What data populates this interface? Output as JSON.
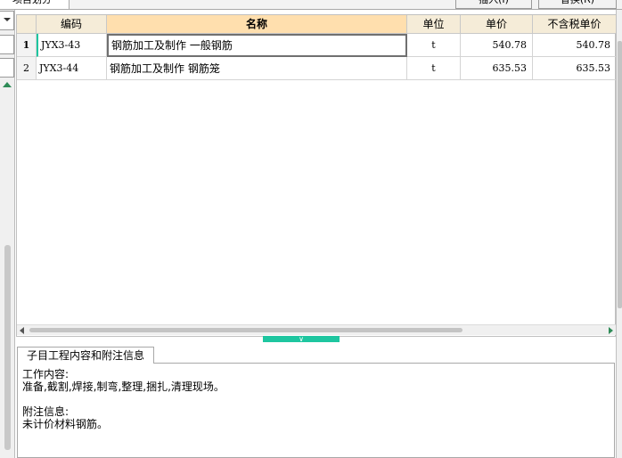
{
  "top_bar": {
    "tab_label": "项目划分",
    "button_insert": "插入(I)",
    "button_replace": "替换(R)"
  },
  "grid": {
    "columns": [
      "",
      "编码",
      "名称",
      "单位",
      "单价",
      "不含税单价"
    ],
    "rows": [
      {
        "num": "1",
        "code": "JYX3-43",
        "name": "钢筋加工及制作 一般钢筋",
        "unit": "t",
        "price": "540.78",
        "price_ex_tax": "540.78"
      },
      {
        "num": "2",
        "code": "JYX3-44",
        "name": "钢筋加工及制作 钢筋笼",
        "unit": "t",
        "price": "635.53",
        "price_ex_tax": "635.53"
      }
    ]
  },
  "info_panel": {
    "tab_label": "子目工程内容和附注信息",
    "work_title": "工作内容:",
    "work_text": "准备,截割,焊接,制弯,整理,捆扎,清理现场。",
    "note_title": "附注信息:",
    "note_text": "未计价材料钢筋。"
  },
  "colors": {
    "accent": "#1ec6a0",
    "header_bg": "#f5ecd8",
    "header_active_bg": "#ffdfae"
  }
}
